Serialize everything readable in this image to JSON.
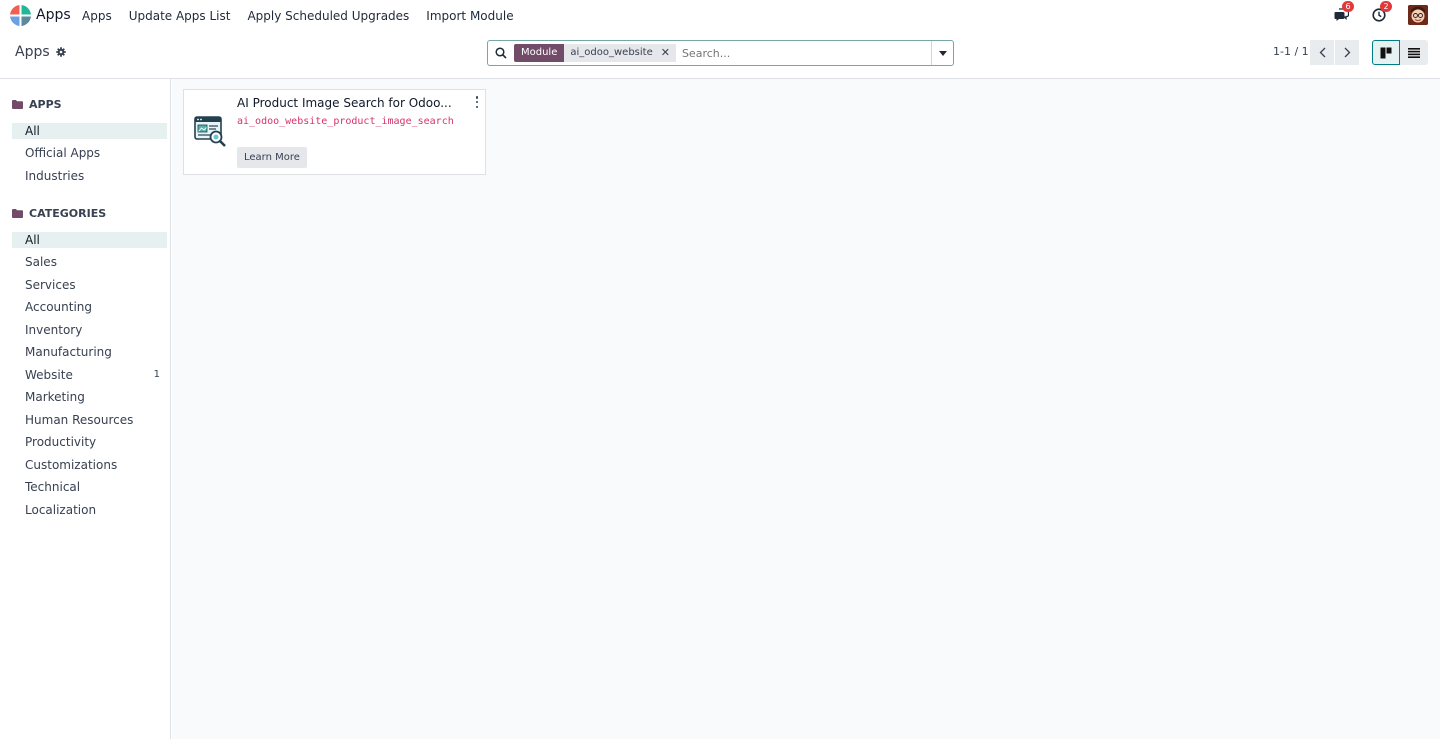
{
  "navbar": {
    "app_name": "Apps",
    "menu": [
      "Apps",
      "Update Apps List",
      "Apply Scheduled Upgrades",
      "Import Module"
    ],
    "messages_count": "6",
    "activities_count": "2"
  },
  "control_panel": {
    "breadcrumb": "Apps",
    "facet_label": "Module",
    "facet_value": "ai_odoo_website",
    "search_placeholder": "Search...",
    "pager": "1-1 / 1"
  },
  "sidebar": {
    "apps_header": "APPS",
    "apps_items": [
      {
        "label": "All",
        "active": true
      },
      {
        "label": "Official Apps"
      },
      {
        "label": "Industries"
      }
    ],
    "categories_header": "CATEGORIES",
    "category_items": [
      {
        "label": "All",
        "active": true,
        "count": ""
      },
      {
        "label": "Sales",
        "count": ""
      },
      {
        "label": "Services",
        "count": ""
      },
      {
        "label": "Accounting",
        "count": ""
      },
      {
        "label": "Inventory",
        "count": ""
      },
      {
        "label": "Manufacturing",
        "count": ""
      },
      {
        "label": "Website",
        "count": "1"
      },
      {
        "label": "Marketing",
        "count": ""
      },
      {
        "label": "Human Resources",
        "count": ""
      },
      {
        "label": "Productivity",
        "count": ""
      },
      {
        "label": "Customizations",
        "count": ""
      },
      {
        "label": "Technical",
        "count": ""
      },
      {
        "label": "Localization",
        "count": ""
      }
    ]
  },
  "card": {
    "title": "AI Product Image Search for Odoo...",
    "technical_name": "ai_odoo_website_product_image_search",
    "button": "Learn More"
  },
  "colors": {
    "brand": "#714b67",
    "accent": "#017e84",
    "badge": "#e23a3a",
    "technical_text": "#d6336c"
  }
}
